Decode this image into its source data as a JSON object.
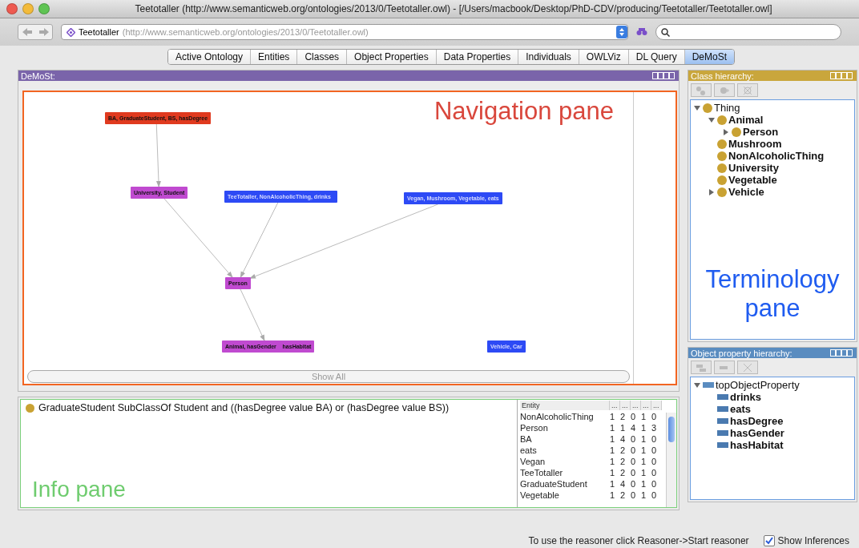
{
  "window": {
    "title": "Teetotaller (http://www.semanticweb.org/ontologies/2013/0/Teetotaller.owl) - [/Users/macbook/Desktop/PhD-CDV/producing/Teetotaller/Teetotaller.owl]"
  },
  "address": {
    "name": "Teetotaller",
    "url": "(http://www.semanticweb.org/ontologies/2013/0/Teetotaller.owl)"
  },
  "tabs": [
    {
      "label": "Active Ontology",
      "selected": false
    },
    {
      "label": "Entities",
      "selected": false
    },
    {
      "label": "Classes",
      "selected": false
    },
    {
      "label": "Object Properties",
      "selected": false
    },
    {
      "label": "Data Properties",
      "selected": false
    },
    {
      "label": "Individuals",
      "selected": false
    },
    {
      "label": "OWLViz",
      "selected": false
    },
    {
      "label": "DL Query",
      "selected": false
    },
    {
      "label": "DeMoSt",
      "selected": true
    }
  ],
  "demost": {
    "title": "DeMoSt:",
    "annotation": "Navigation pane",
    "show_all": "Show All",
    "nodes": [
      {
        "label": "BA, GraduateStudent, BS, hasDegree",
        "color": "#e03a1f"
      },
      {
        "label": "University, Student",
        "color": "#c04ad0"
      },
      {
        "label": "TeeTotaller, NonAlcoholicThing, drinks",
        "color": "#2d4af5"
      },
      {
        "label": "Vegan, Mushroom, Vegetable, eats",
        "color": "#2d4af5"
      },
      {
        "label": "Person",
        "color": "#c04ad0"
      },
      {
        "label": "Animal, hasGender    hasHabitat",
        "color": "#c04ad0"
      },
      {
        "label": "Vehicle, Car",
        "color": "#2d4af5"
      }
    ]
  },
  "info": {
    "axiom": "GraduateStudent SubClassOf Student and ((hasDegree value BA) or (hasDegree value BS))",
    "annotation": "Info pane",
    "table": {
      "columns": [
        "Entity",
        "...",
        "...",
        "...",
        "...",
        "..."
      ],
      "rows": [
        [
          "NonAlcoholicThing",
          "1",
          "2",
          "0",
          "1",
          "0"
        ],
        [
          "Person",
          "1",
          "1",
          "4",
          "1",
          "3"
        ],
        [
          "BA",
          "1",
          "4",
          "0",
          "1",
          "0"
        ],
        [
          "eats",
          "1",
          "2",
          "0",
          "1",
          "0"
        ],
        [
          "Vegan",
          "1",
          "2",
          "0",
          "1",
          "0"
        ],
        [
          "TeeTotaller",
          "1",
          "2",
          "0",
          "1",
          "0"
        ],
        [
          "GraduateStudent",
          "1",
          "4",
          "0",
          "1",
          "0"
        ],
        [
          "Vegetable",
          "1",
          "2",
          "0",
          "1",
          "0"
        ]
      ]
    }
  },
  "class_hierarchy": {
    "title": "Class hierarchy:",
    "annotation": [
      "Terminology",
      "pane"
    ],
    "tree": [
      {
        "label": "Thing",
        "kind": "root",
        "expanded": true,
        "children": [
          {
            "label": "Animal",
            "kind": "group",
            "expanded": true,
            "children": [
              {
                "label": "Person",
                "kind": "group",
                "expanded": false
              }
            ]
          },
          {
            "label": "Mushroom",
            "kind": "leaf"
          },
          {
            "label": "NonAlcoholicThing",
            "kind": "leaf"
          },
          {
            "label": "University",
            "kind": "leaf"
          },
          {
            "label": "Vegetable",
            "kind": "leaf"
          },
          {
            "label": "Vehicle",
            "kind": "group",
            "expanded": false
          }
        ]
      }
    ]
  },
  "object_property_hierarchy": {
    "title": "Object property hierarchy:",
    "tree": [
      {
        "label": "topObjectProperty",
        "kind": "root",
        "expanded": true,
        "children": [
          {
            "label": "drinks",
            "kind": "leaf"
          },
          {
            "label": "eats",
            "kind": "leaf"
          },
          {
            "label": "hasDegree",
            "kind": "leaf"
          },
          {
            "label": "hasGender",
            "kind": "leaf"
          },
          {
            "label": "hasHabitat",
            "kind": "leaf"
          }
        ]
      }
    ]
  },
  "status_bar": {
    "message": "To use the reasoner click Reasoner->Start reasoner",
    "show_inferences": {
      "label": "Show Inferences",
      "checked": true
    }
  }
}
